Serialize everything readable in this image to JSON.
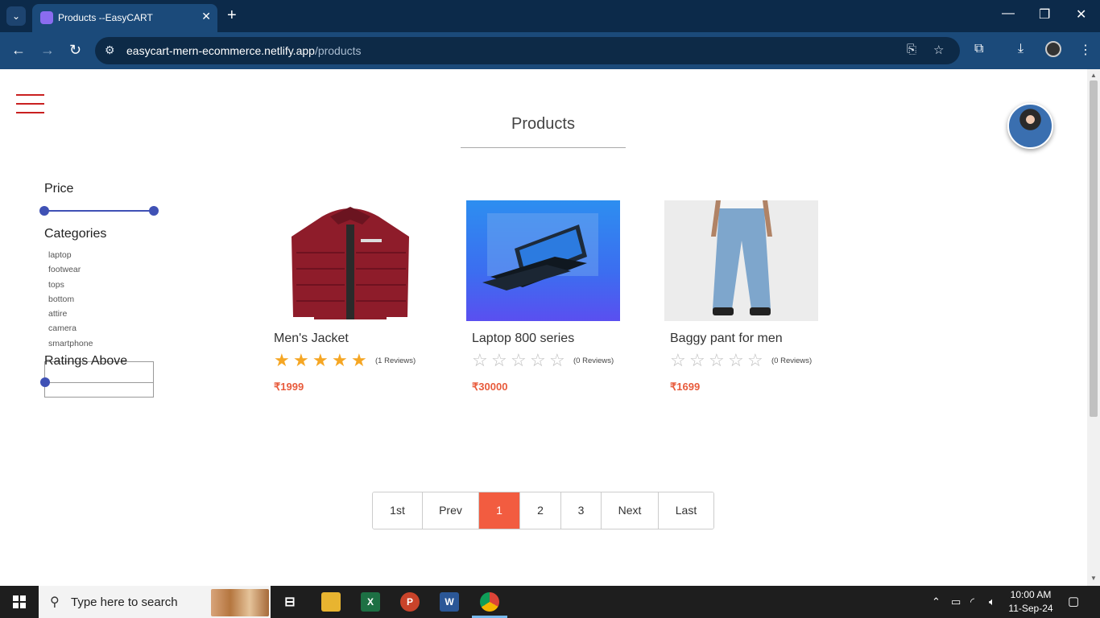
{
  "browser": {
    "tab_title": "Products --EasyCART",
    "url_domain": "easycart-mern-ecommerce.netlify.app",
    "url_path": "/products"
  },
  "page": {
    "heading": "Products",
    "filters": {
      "price_label": "Price",
      "categories_label": "Categories",
      "categories": [
        "laptop",
        "footwear",
        "tops",
        "bottom",
        "attire",
        "camera",
        "smartphone"
      ],
      "ratings_label": "Ratings Above"
    },
    "products": [
      {
        "name": "Men's Jacket",
        "rating": 5,
        "reviews": "(1 Reviews)",
        "price": "₹1999",
        "image_icon": "jacket-image"
      },
      {
        "name": "Laptop 800 series",
        "rating": 0,
        "reviews": "(0 Reviews)",
        "price": "₹30000",
        "image_icon": "laptop-image"
      },
      {
        "name": "Baggy pant for men",
        "rating": 0,
        "reviews": "(0 Reviews)",
        "price": "₹1699",
        "image_icon": "pants-image"
      }
    ],
    "pagination": {
      "first": "1st",
      "prev": "Prev",
      "pages": [
        "1",
        "2",
        "3"
      ],
      "current": "1",
      "next": "Next",
      "last": "Last"
    }
  },
  "taskbar": {
    "search_placeholder": "Type here to search",
    "time": "10:00 AM",
    "date": "11-Sep-24"
  },
  "colors": {
    "accent": "#f25c40",
    "slider": "#3f51b5",
    "star": "#f5a623",
    "hamburger": "#c92020"
  }
}
